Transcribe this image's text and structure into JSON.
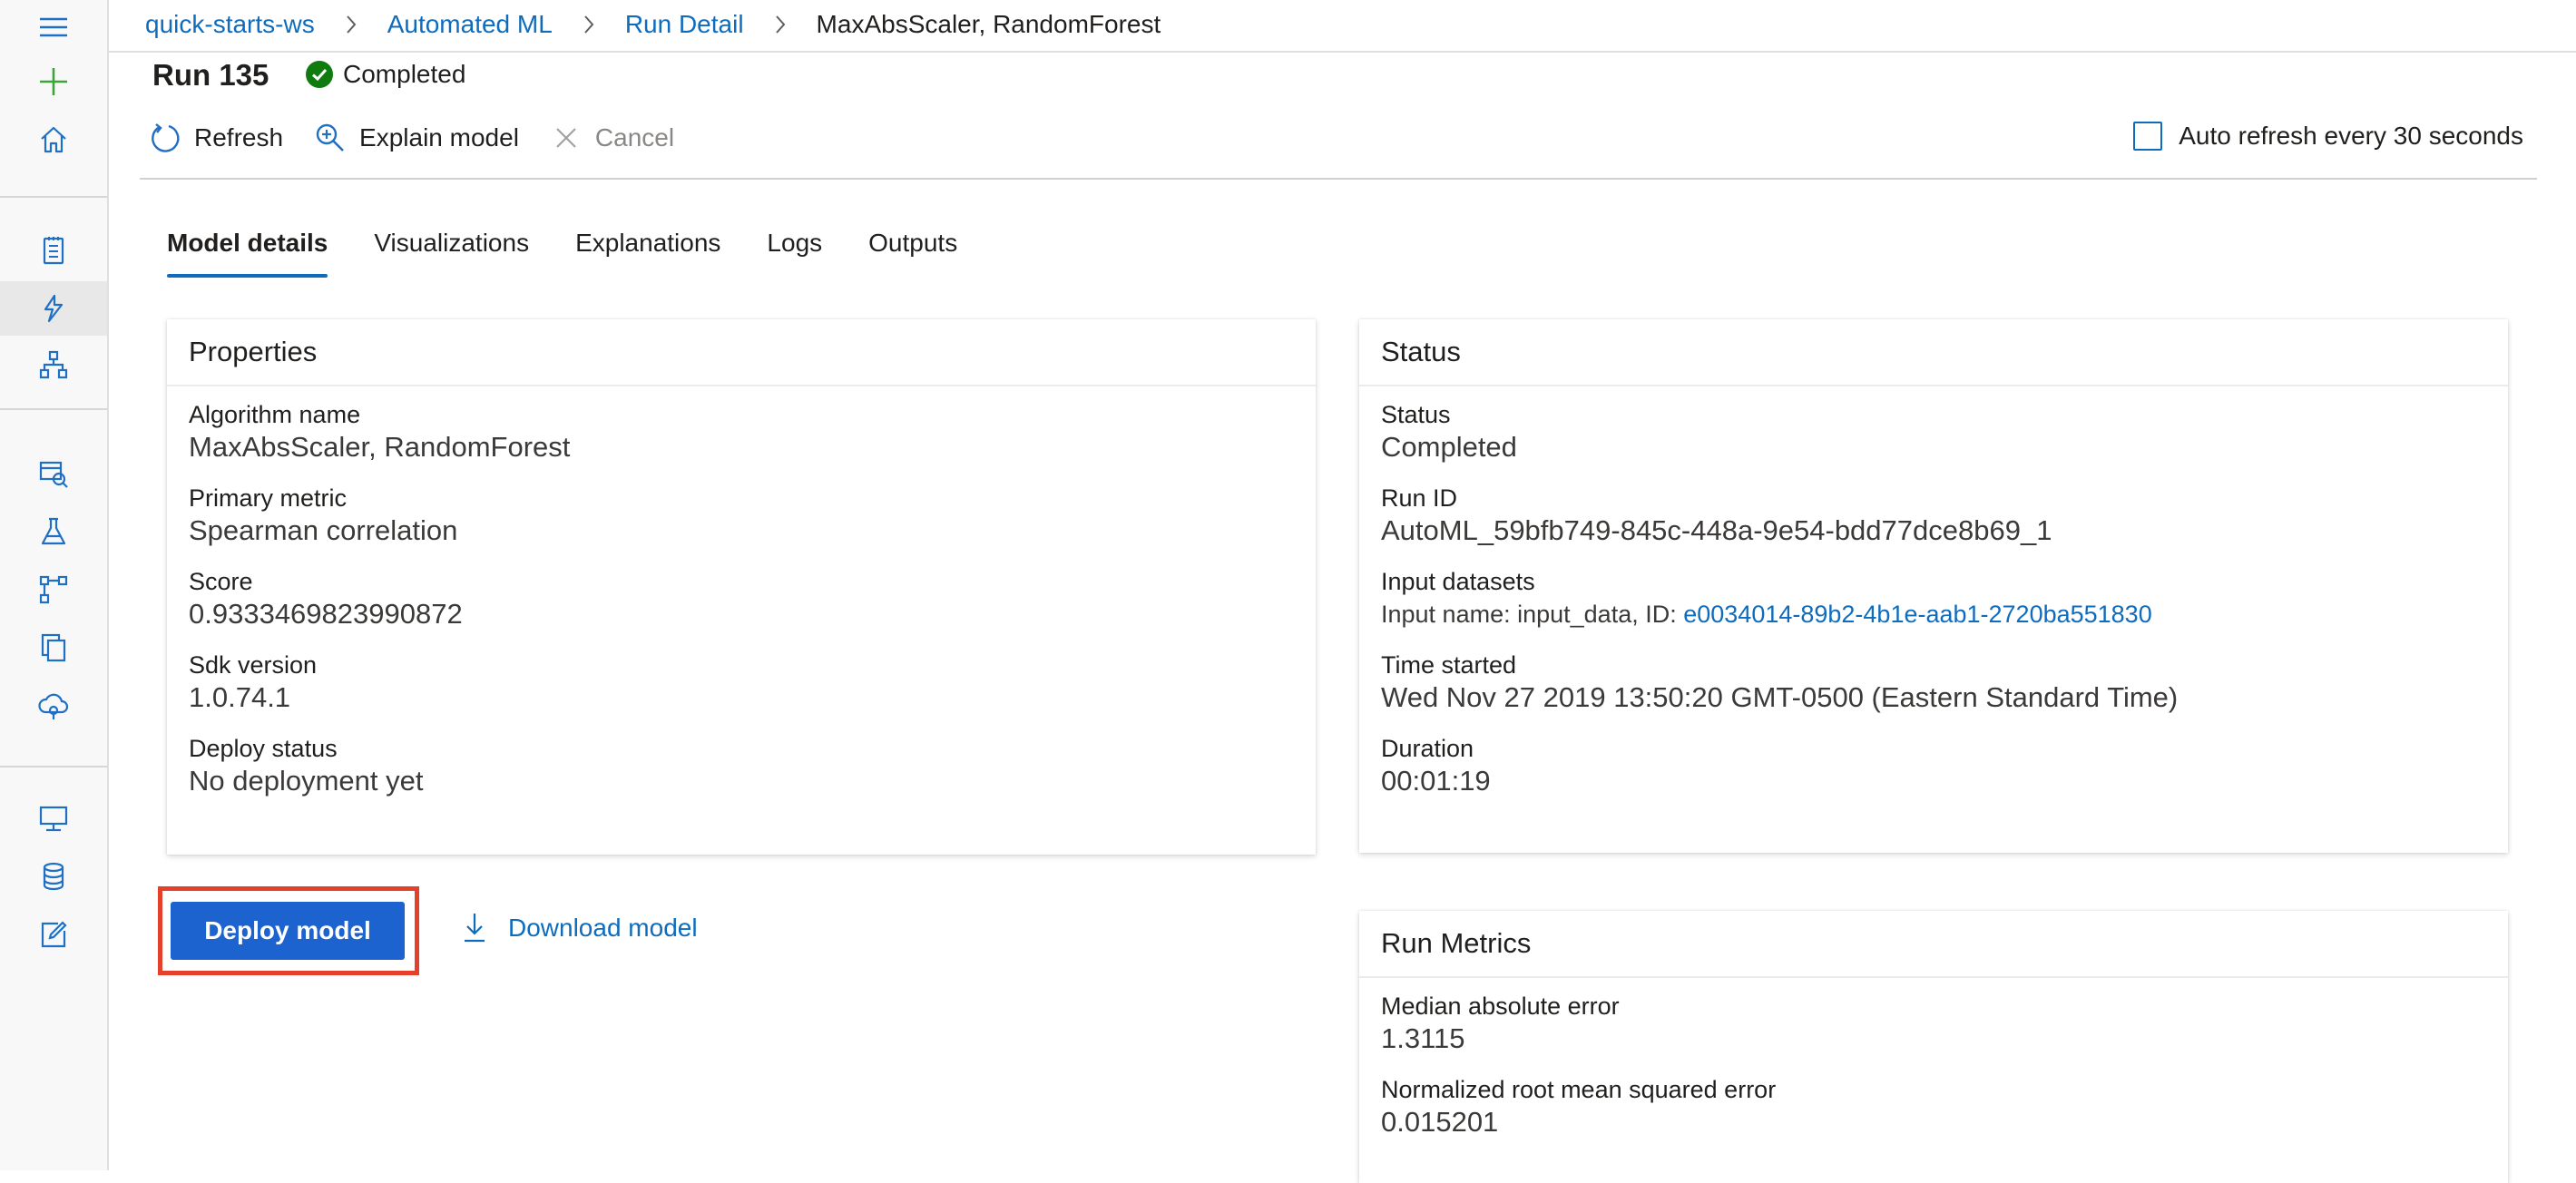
{
  "nav": {
    "items": [
      {
        "icon": "hamburger-menu-icon"
      },
      {
        "icon": "plus-icon"
      },
      {
        "icon": "home-icon"
      },
      {
        "icon": "notebook-icon"
      },
      {
        "icon": "automated-ml-icon"
      },
      {
        "icon": "designer-icon"
      },
      {
        "icon": "datasets-icon"
      },
      {
        "icon": "experiments-icon"
      },
      {
        "icon": "pipelines-icon"
      },
      {
        "icon": "models-icon"
      },
      {
        "icon": "endpoints-icon"
      },
      {
        "icon": "compute-icon"
      },
      {
        "icon": "datastores-icon"
      },
      {
        "icon": "data-labeling-icon"
      }
    ]
  },
  "breadcrumb": {
    "items": [
      "quick-starts-ws",
      "Automated ML",
      "Run Detail"
    ],
    "current": "MaxAbsScaler, RandomForest"
  },
  "run": {
    "title": "Run 135",
    "status": "Completed",
    "status_color": "#107c10"
  },
  "commands": {
    "refresh": "Refresh",
    "explain": "Explain model",
    "cancel": "Cancel",
    "auto_refresh": "Auto refresh every 30 seconds"
  },
  "tabs": [
    "Model details",
    "Visualizations",
    "Explanations",
    "Logs",
    "Outputs"
  ],
  "properties": {
    "header": "Properties",
    "items": [
      {
        "label": "Algorithm name",
        "value": "MaxAbsScaler, RandomForest"
      },
      {
        "label": "Primary metric",
        "value": "Spearman correlation"
      },
      {
        "label": "Score",
        "value": "0.9333469823990872"
      },
      {
        "label": "Sdk version",
        "value": "1.0.74.1"
      },
      {
        "label": "Deploy status",
        "value": "No deployment yet"
      }
    ]
  },
  "status_card": {
    "header": "Status",
    "status_label": "Status",
    "status_value": "Completed",
    "run_id_label": "Run ID",
    "run_id_value": "AutoML_59bfb749-845c-448a-9e54-bdd77dce8b69_1",
    "input_label": "Input datasets",
    "input_prefix": "Input name: input_data, ID:",
    "input_id": "e0034014-89b2-4b1e-aab1-2720ba551830",
    "time_label": "Time started",
    "time_value": "Wed Nov 27 2019 13:50:20 GMT-0500 (Eastern Standard Time)",
    "duration_label": "Duration",
    "duration_value": "00:01:19"
  },
  "metrics": {
    "header": "Run Metrics",
    "items": [
      {
        "label": "Median absolute error",
        "value": "1.3115"
      },
      {
        "label": "Normalized root mean squared error",
        "value": "0.015201"
      }
    ]
  },
  "actions": {
    "deploy": "Deploy model",
    "download": "Download model"
  },
  "colors": {
    "accent": "#0f6cbd",
    "primary_button": "#1d63cf",
    "highlight": "#e5402c",
    "nav_icon": "#1f6fc5",
    "plus_icon": "#3ba53b"
  }
}
